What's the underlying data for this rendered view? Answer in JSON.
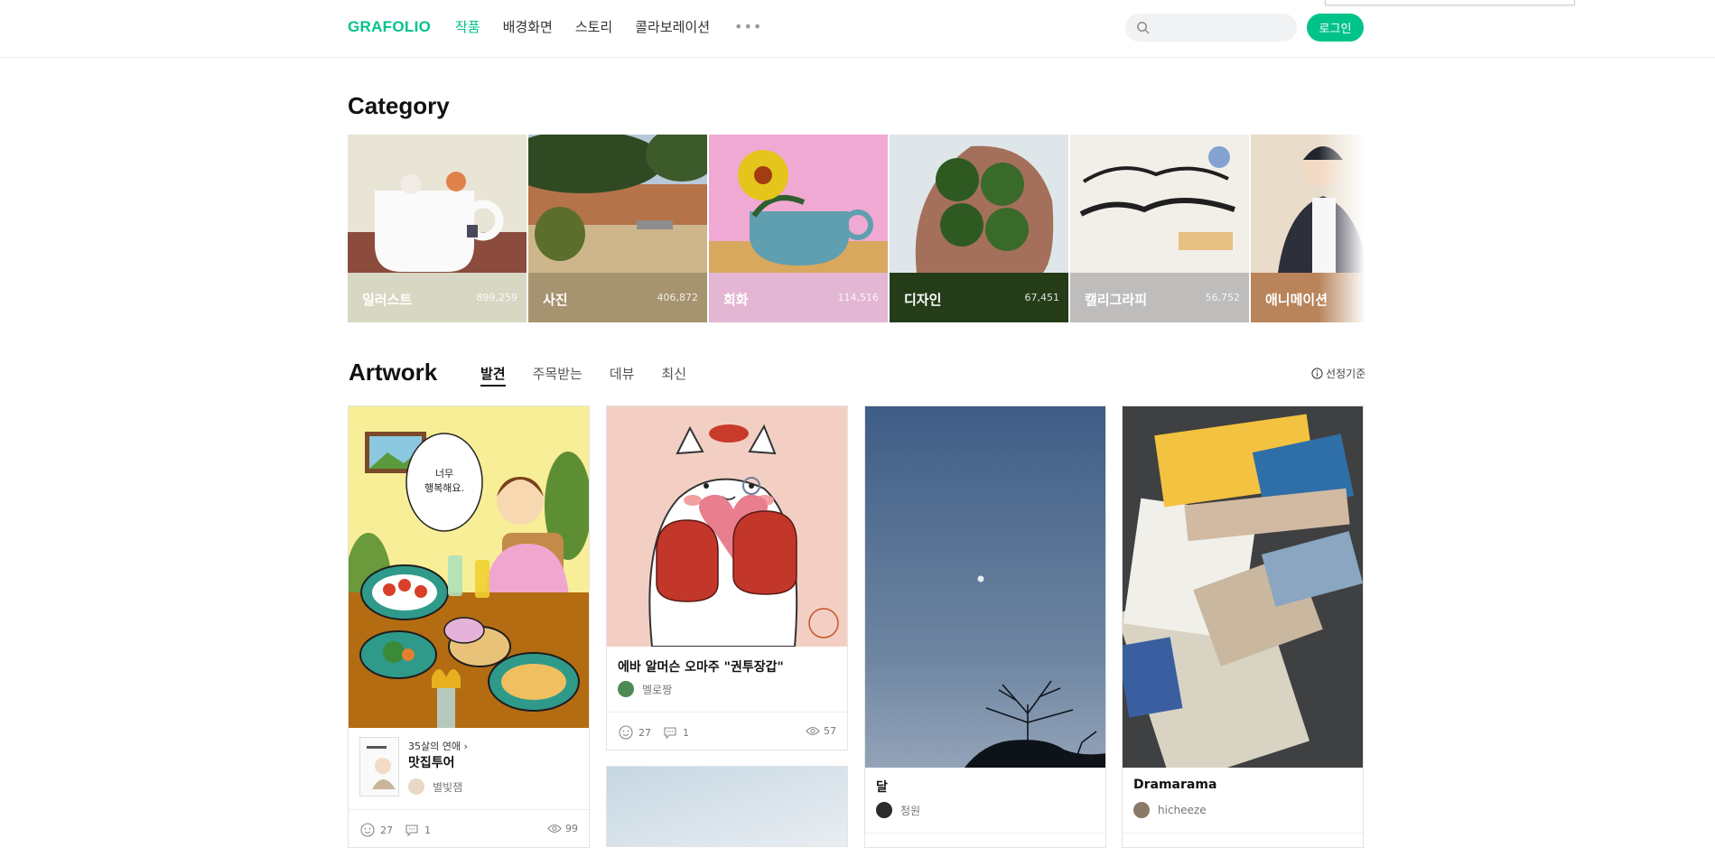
{
  "header": {
    "logo": "GRAFOLIO",
    "nav": [
      "작품",
      "배경화면",
      "스토리",
      "콜라보레이션"
    ],
    "more": "•••",
    "search_placeholder": "",
    "login_label": "로그인"
  },
  "category": {
    "title": "Category",
    "items": [
      {
        "name": "일러스트",
        "count": "899,259",
        "color": "#d8d7c3"
      },
      {
        "name": "사진",
        "count": "406,872",
        "color": "#a6936f"
      },
      {
        "name": "회화",
        "count": "114,516",
        "color": "#e3b6d4"
      },
      {
        "name": "디자인",
        "count": "67,451",
        "color": "#243d18"
      },
      {
        "name": "캘리그라피",
        "count": "56,752",
        "color": "#bfbcbc"
      },
      {
        "name": "애니메이션",
        "count": "",
        "color": "#b9845a"
      }
    ]
  },
  "artwork": {
    "title": "Artwork",
    "tabs": [
      "발견",
      "주목받는",
      "데뷰",
      "최신"
    ],
    "criteria_label": "선정기준",
    "cards": [
      {
        "series": "35살의 연애",
        "title": "맛집투어",
        "author": "별빛잼",
        "likes": "27",
        "comments": "1",
        "views": "99",
        "thumb_caption": "너무 행복해요."
      },
      {
        "title": "에바 알머슨 오마주 \"권투장갑\"",
        "author": "멜로짱",
        "likes": "27",
        "comments": "1",
        "views": "57"
      },
      {
        "title": "달",
        "author": "청원"
      },
      {
        "title": "Dramarama",
        "author": "hicheeze"
      }
    ]
  }
}
